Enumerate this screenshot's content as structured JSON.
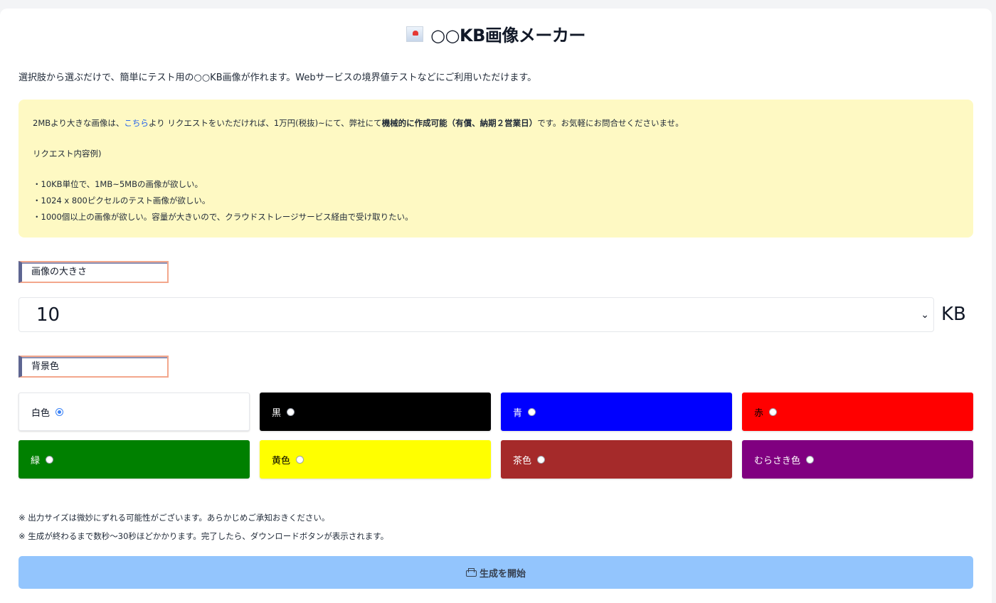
{
  "header": {
    "title": "○○KB画像メーカー",
    "logo_icon": "image-icon"
  },
  "subtitle": "選択肢から選ぶだけで、簡単にテスト用の○○KB画像が作れます。Webサービスの境界値テストなどにご利用いただけます。",
  "notice": {
    "text_before_link": "2MBより大きな画像は、",
    "link_label": "こちら",
    "text_after_link": "より リクエストをいただければ、1万円(税抜)~にて、弊社にて",
    "strong_text": "機械的に作成可能（有償、納期２営業日）",
    "text_end": "です。お気軽にお問合せくださいませ。",
    "examples_heading": "リクエスト内容例)",
    "examples": [
      "・10KB単位で、1MB~5MBの画像が欲しい。",
      "・1024 x 800ピクセルのテスト画像が欲しい。",
      "・1000個以上の画像が欲しい。容量が大きいので、クラウドストレージサービス経由で受け取りたい。"
    ]
  },
  "size_section": {
    "label": "画像の大きさ",
    "selected_value": "10",
    "unit": "KB"
  },
  "color_section": {
    "label": "背景色",
    "options": [
      {
        "label": "白色",
        "bg": "#ffffff",
        "fg": "#111827",
        "selected": true
      },
      {
        "label": "黒",
        "bg": "#000000",
        "fg": "#ffffff",
        "selected": false
      },
      {
        "label": "青",
        "bg": "#0000ff",
        "fg": "#ffffff",
        "selected": false
      },
      {
        "label": "赤",
        "bg": "#ff0000",
        "fg": "#000000",
        "selected": false
      },
      {
        "label": "緑",
        "bg": "#008000",
        "fg": "#ffffff",
        "selected": false
      },
      {
        "label": "黄色",
        "bg": "#ffff00",
        "fg": "#000000",
        "selected": false
      },
      {
        "label": "茶色",
        "bg": "#a52a2a",
        "fg": "#ffffff",
        "selected": false
      },
      {
        "label": "むらさき色",
        "bg": "#800080",
        "fg": "#ffffff",
        "selected": false
      }
    ]
  },
  "notes": [
    "※ 出力サイズは微妙にずれる可能性がございます。あらかじめご承知おきください。",
    "※ 生成が終わるまで数秒〜30秒ほどかかります。完了したら、ダウンロードボタンが表示されます。"
  ],
  "generate_button": {
    "label": "生成を開始",
    "icon": "print-icon",
    "color": "#93c5fd"
  }
}
